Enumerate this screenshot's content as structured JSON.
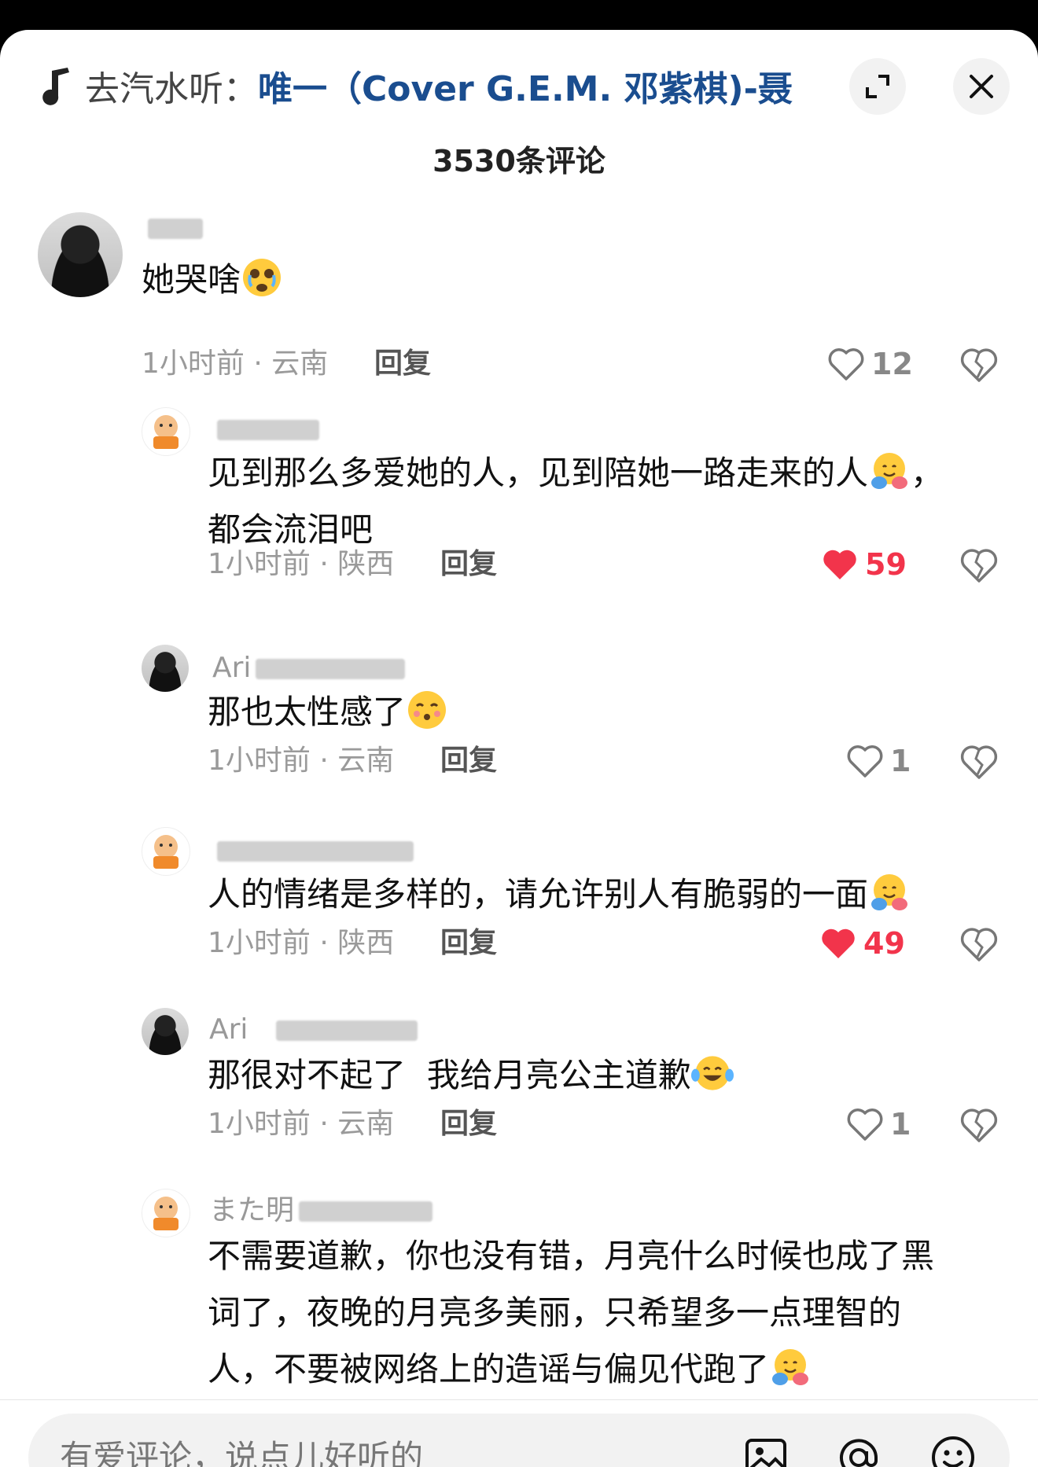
{
  "header": {
    "source_prefix": "去汽水听：",
    "song_title": "唯一（Cover G.E.M. 邓紫棋)-聂...",
    "music_icon": "music-note-icon",
    "expand_icon": "expand-icon",
    "close_icon": "close-icon"
  },
  "comment_count": "3530条评论",
  "comments": [
    {
      "username": "",
      "text": "她哭啥",
      "emoji": "crying-face-emoji",
      "time_location": "1小时前 · 云南",
      "reply": "回复",
      "likes": "12",
      "liked": false,
      "avatar": "girl"
    },
    {
      "username": "",
      "text": "见到那么多爱她的人，见到陪她一路走来的人",
      "text_tail": "，",
      "text_line2": "都会流泪吧",
      "emoji": "hugging-face-emoji",
      "time_location": "1小时前 · 陕西",
      "reply": "回复",
      "likes": "59",
      "liked": true,
      "avatar": "mascot"
    },
    {
      "username": "Ari",
      "text": "那也太性感了",
      "emoji": "kissing-face-emoji",
      "time_location": "1小时前 · 云南",
      "reply": "回复",
      "likes": "1",
      "liked": false,
      "avatar": "girl"
    },
    {
      "username": "",
      "text": "人的情绪是多样的，请允许别人有脆弱的一面",
      "emoji": "hugging-face-emoji",
      "time_location": "1小时前 · 陕西",
      "reply": "回复",
      "likes": "49",
      "liked": true,
      "avatar": "mascot"
    },
    {
      "username": "Ari",
      "text": "那很对不起了  我给月亮公主道歉",
      "emoji": "tears-of-joy-emoji",
      "time_location": "1小时前 · 云南",
      "reply": "回复",
      "likes": "1",
      "liked": false,
      "avatar": "girl"
    },
    {
      "username": "また明",
      "text_line1": "不需要道歉，你也没有错，月亮什么时候也成了黑",
      "text_line2": "词了，夜晚的月亮多美丽，只希望多一点理智的",
      "text_line3": "人，不要被网络上的造谣与偏见代跑了",
      "emoji": "hugging-face-emoji",
      "avatar": "mascot"
    }
  ],
  "footer": {
    "placeholder": "有爱评论，说点儿好听的",
    "image_icon": "image-icon",
    "mention_icon": "at-mention-icon",
    "emoji_icon": "smiley-icon"
  },
  "colors": {
    "like_red": "#f2344b",
    "song_blue": "#1a4d8f",
    "meta_gray": "#9a9a9a"
  }
}
